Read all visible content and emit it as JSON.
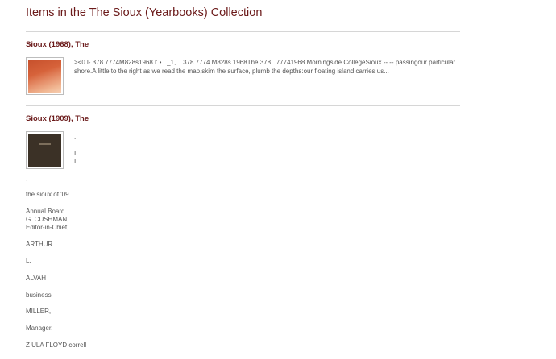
{
  "page": {
    "title": "Items in the The Sioux (Yearbooks) Collection"
  },
  "items": [
    {
      "title": "Sioux (1968), The",
      "description": "><0 l- 378.7774M828s1968 l' • . _1,. . 378.7774 M828s 1968The 378 . 77741968 Morningside CollegeSioux -- -- passingour particular shore.A little to the right as we read the map,skim the surface, plumb the depths:our floating island carries us..."
    },
    {
      "title": "Sioux (1909), The",
      "side_fragments": [
        "..",
        "I",
        "I"
      ],
      "text_fragments": [
        ",",
        "the sioux of '09",
        "Annual Board",
        "G. CUSHMAN,",
        "Editor-in-Chief,",
        "ARTHUR",
        "L.",
        "ALVAH",
        "business",
        "MILLER,",
        "Manager.",
        "Z ULA FLOYD correll"
      ]
    }
  ]
}
